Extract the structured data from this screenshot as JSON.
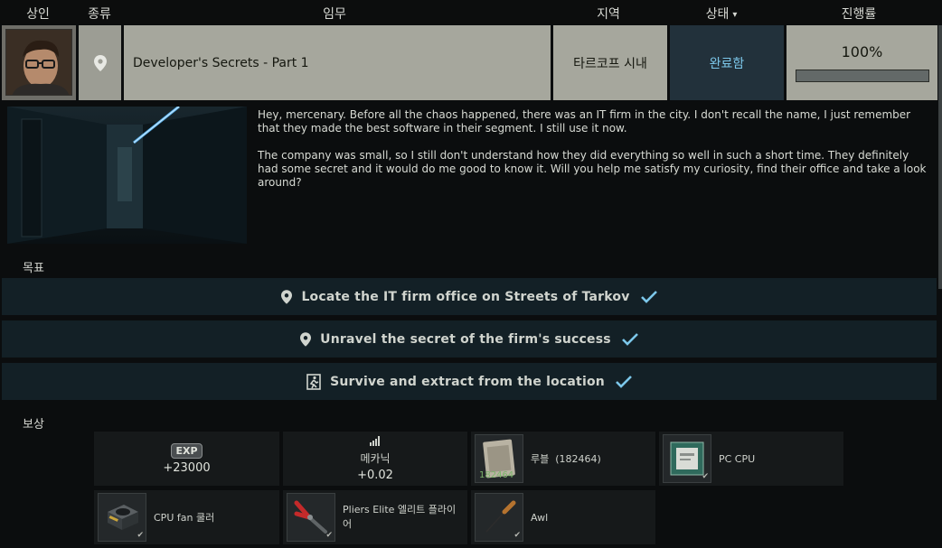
{
  "header": {
    "trader": "상인",
    "type": "종류",
    "quest": "임무",
    "location": "지역",
    "status": "상태",
    "progress": "진행률"
  },
  "quest": {
    "trader_icon": "trader-portrait-mechanic",
    "type_icon": "location-pin-icon",
    "name": "Developer's Secrets - Part 1",
    "location": "타르코프 시내",
    "status": "완료함",
    "progress_label": "100%",
    "progress_value": 1.0
  },
  "description": {
    "paragraphs": [
      "Hey, mercenary. Before all the chaos happened, there was an IT firm in the city. I don't recall the name, I just remember that they made the best software in their segment. I still use it now.",
      "The company was small, so I still don't understand how they did everything so well in such a short time. They definitely had some secret and it would do me good to know it. Will you help me satisfy my curiosity, find their office and take a look around?"
    ]
  },
  "objectives_label": "목표",
  "objectives": [
    {
      "icon": "location-pin-icon",
      "text": "Locate the IT firm office on Streets of Tarkov",
      "done": true
    },
    {
      "icon": "location-pin-icon",
      "text": "Unravel the secret of the firm's success",
      "done": true
    },
    {
      "icon": "exit-icon",
      "text": "Survive and extract from the location",
      "done": true
    }
  ],
  "rewards_label": "보상",
  "rewards": {
    "exp": {
      "badge": "EXP",
      "value": "+23000"
    },
    "skill": {
      "icon": "skill-mechanic-icon",
      "name": "메카닉",
      "value": "+0.02"
    },
    "roubles": {
      "icon": "roubles-icon",
      "name": "루블",
      "amount": "(182464)",
      "sub": "182464"
    },
    "pc_cpu": {
      "icon": "pc-cpu-icon",
      "name": "PC CPU"
    },
    "cpu_fan": {
      "icon": "cpu-fan-icon",
      "name": "CPU  fan 쿨러"
    },
    "pliers": {
      "icon": "pliers-icon",
      "name": "Pliers Elite 엘리트 플라이어"
    },
    "awl": {
      "icon": "awl-icon",
      "name": "Awl"
    }
  },
  "colors": {
    "status_text": "#7cc7ea",
    "check": "#7cc7ea",
    "objective_bg": "#132026"
  }
}
